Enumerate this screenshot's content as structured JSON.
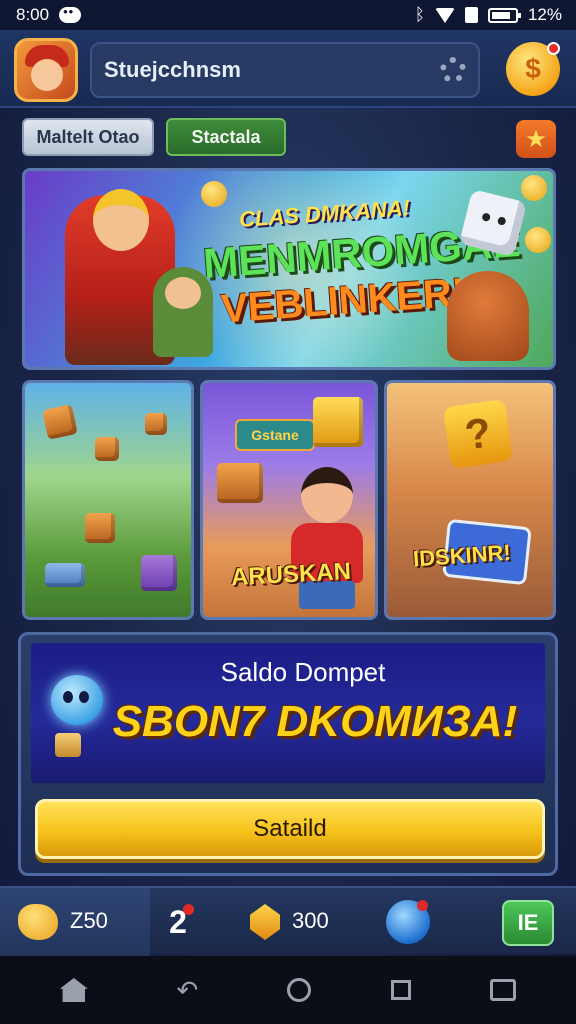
{
  "status_bar": {
    "time": "8:00",
    "battery": "12%",
    "icons": [
      "message-icon",
      "bluetooth-icon",
      "wifi-icon",
      "sim-icon",
      "battery-icon"
    ]
  },
  "header": {
    "search_text": "Stuejcchnsm",
    "icons": [
      "avatar",
      "gear-icon",
      "coin-icon"
    ]
  },
  "tabs": [
    {
      "label": "Maltelt Otao"
    },
    {
      "label": "Stactala"
    }
  ],
  "hero_banner": {
    "subtitle": "CLAS DMKANA!",
    "line1": "MENMROMGAE",
    "line2": "VEBLINKER!"
  },
  "game_cards": [
    {
      "label": ""
    },
    {
      "sign": "Gstane",
      "label": "ARUSKAN"
    },
    {
      "label": "IDSKINR!"
    }
  ],
  "wallet": {
    "title": "Saldo Dompet",
    "amount": "SBON7 DKOMИЗA!",
    "button_label": "Sataild"
  },
  "bottom_bar": {
    "coins": "Z50",
    "level": "2",
    "gems": "300",
    "menu_label": "IE"
  },
  "colors": {
    "accent_yellow": "#f6c21a",
    "panel_blue": "#1e2e55",
    "tab_green": "#2a6b2b",
    "wallet_purple": "#242a9a"
  }
}
